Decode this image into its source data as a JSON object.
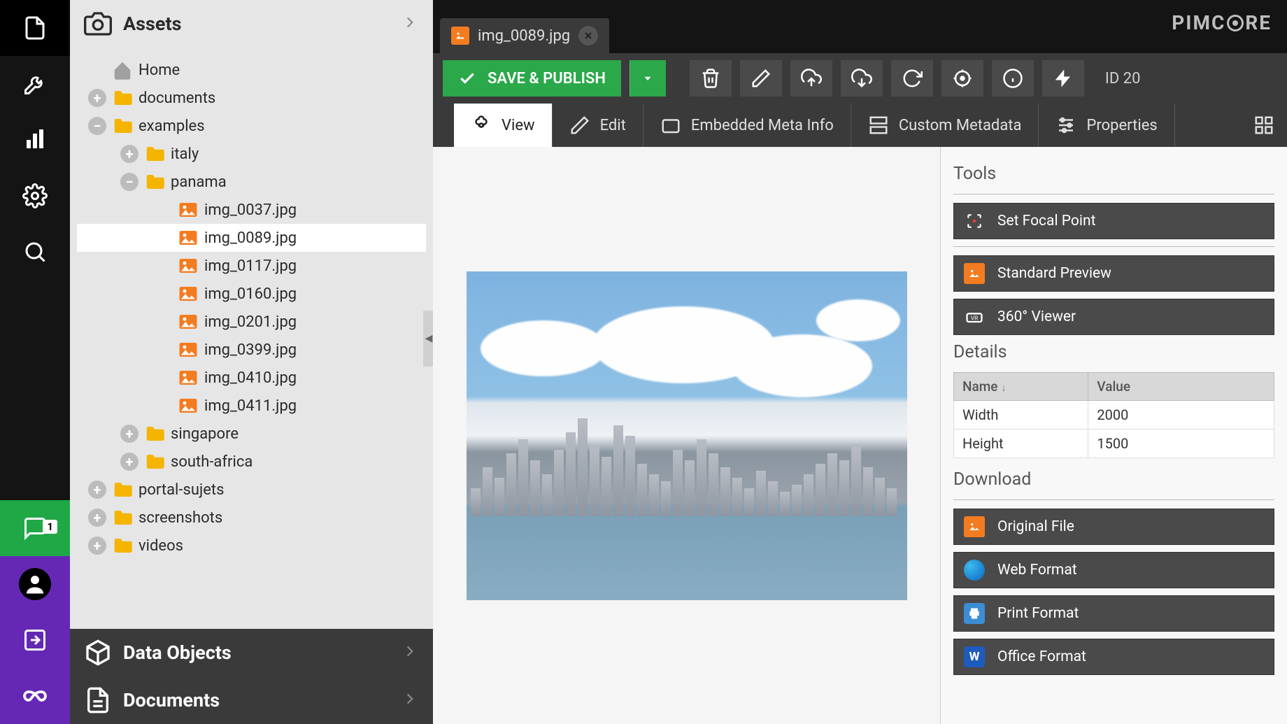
{
  "brand": "PIMCORE",
  "notifications_badge": "1",
  "sidebar": {
    "assets_title": "Assets",
    "data_objects_title": "Data Objects",
    "documents_title": "Documents",
    "tree": {
      "home": "Home",
      "documents": "documents",
      "examples": "examples",
      "italy": "italy",
      "panama": "panama",
      "files": [
        "img_0037.jpg",
        "img_0089.jpg",
        "img_0117.jpg",
        "img_0160.jpg",
        "img_0201.jpg",
        "img_0399.jpg",
        "img_0410.jpg",
        "img_0411.jpg"
      ],
      "singapore": "singapore",
      "south_africa": "south-africa",
      "portal_sujets": "portal-sujets",
      "screenshots": "screenshots",
      "videos": "videos"
    }
  },
  "tab": {
    "filename": "img_0089.jpg"
  },
  "toolbar": {
    "save_publish": "SAVE & PUBLISH",
    "id_label": "ID 20"
  },
  "subtabs": {
    "view": "View",
    "edit": "Edit",
    "embedded": "Embedded Meta Info",
    "custom": "Custom Metadata",
    "properties": "Properties"
  },
  "right": {
    "tools_h": "Tools",
    "focal": "Set Focal Point",
    "std_preview": "Standard Preview",
    "viewer360": "360° Viewer",
    "details_h": "Details",
    "col_name": "Name",
    "col_value": "Value",
    "rows": [
      {
        "name": "Width",
        "value": "2000"
      },
      {
        "name": "Height",
        "value": "1500"
      }
    ],
    "download_h": "Download",
    "dl_original": "Original File",
    "dl_web": "Web Format",
    "dl_print": "Print Format",
    "dl_office": "Office Format"
  }
}
